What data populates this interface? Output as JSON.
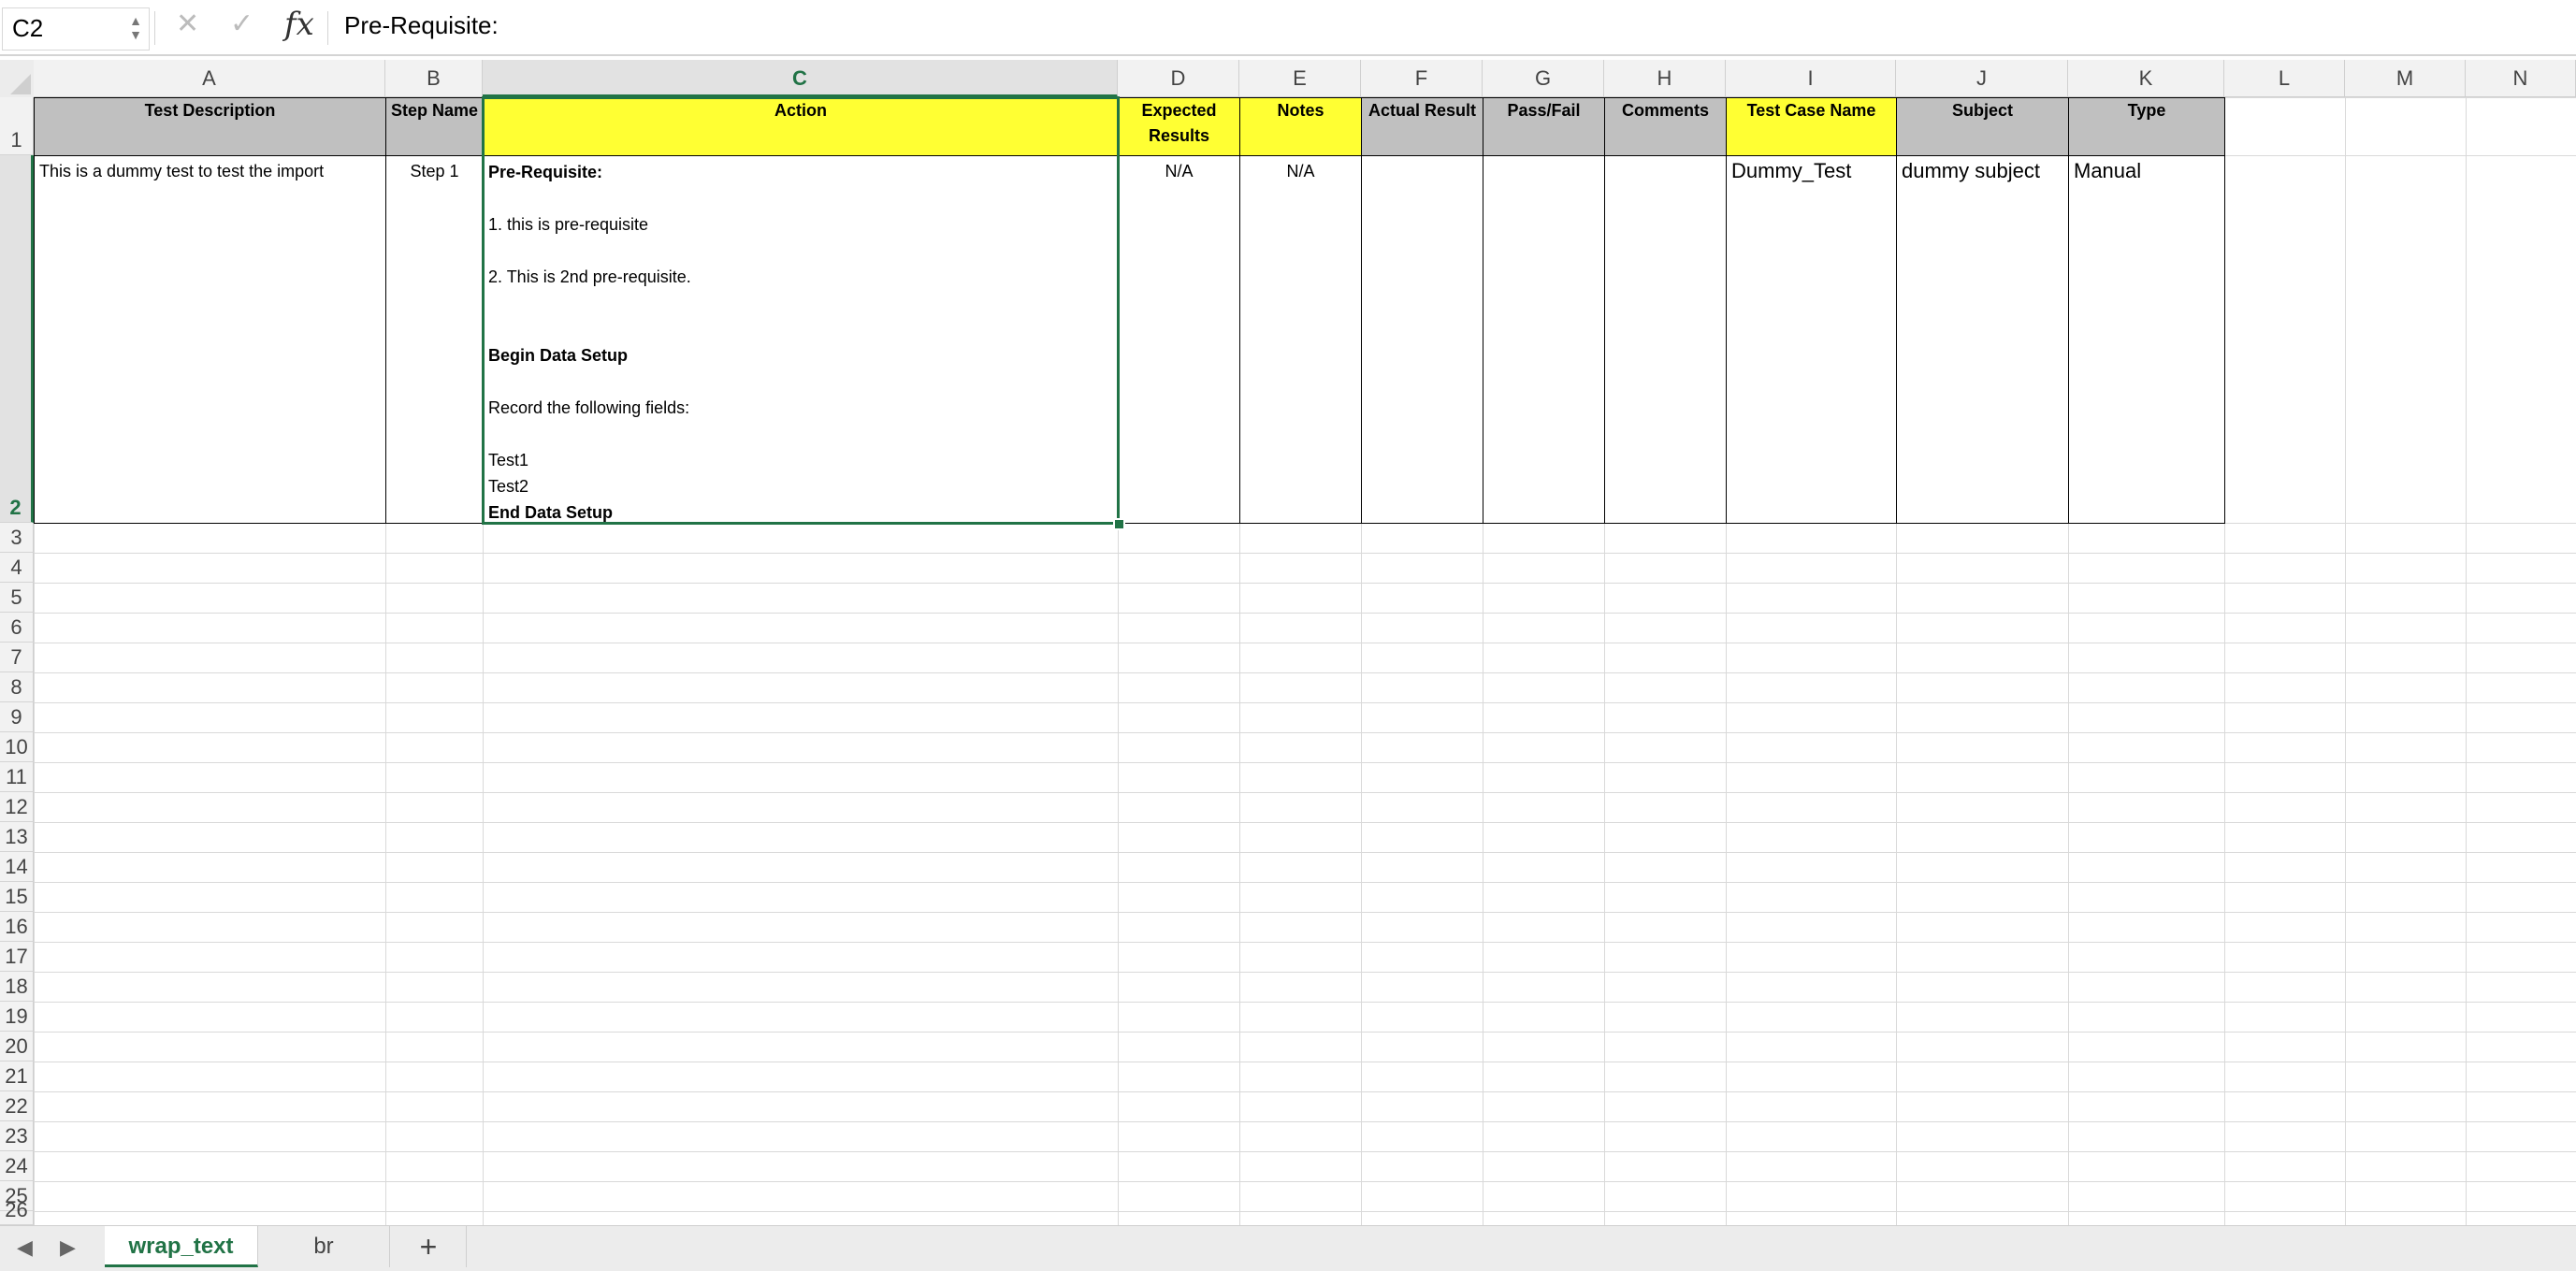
{
  "formula_bar": {
    "name_box": "C2",
    "cancel_glyph": "✕",
    "enter_glyph": "✓",
    "fx_label": "fx",
    "formula": "Pre-Requisite:"
  },
  "columns": [
    "A",
    "B",
    "C",
    "D",
    "E",
    "F",
    "G",
    "H",
    "I",
    "J",
    "K",
    "L",
    "M",
    "N"
  ],
  "selected_column": "C",
  "rows": [
    "1",
    "2",
    "3",
    "4",
    "5",
    "6",
    "7",
    "8",
    "9",
    "10",
    "11",
    "12",
    "13",
    "14",
    "15",
    "16",
    "17",
    "18",
    "19",
    "20",
    "21",
    "22",
    "23",
    "24",
    "25",
    "26"
  ],
  "selected_row": "2",
  "header_row": [
    {
      "col": "A",
      "text": "Test Description",
      "fill": "gray"
    },
    {
      "col": "B",
      "text": "Step Name",
      "fill": "gray"
    },
    {
      "col": "C",
      "text": "Action",
      "fill": "yellow"
    },
    {
      "col": "D",
      "text": "Expected Results",
      "fill": "yellow"
    },
    {
      "col": "E",
      "text": "Notes",
      "fill": "yellow"
    },
    {
      "col": "F",
      "text": "Actual Result",
      "fill": "gray"
    },
    {
      "col": "G",
      "text": "Pass/Fail",
      "fill": "gray"
    },
    {
      "col": "H",
      "text": "Comments",
      "fill": "gray"
    },
    {
      "col": "I",
      "text": "Test Case Name",
      "fill": "yellow"
    },
    {
      "col": "J",
      "text": "Subject",
      "fill": "gray"
    },
    {
      "col": "K",
      "text": "Type",
      "fill": "gray"
    }
  ],
  "data_row": {
    "A": "This is a dummy test to test the import",
    "B": "Step 1",
    "C_lines": [
      {
        "text": "Pre-Requisite:",
        "bold": true
      },
      {
        "text": "",
        "bold": false
      },
      {
        "text": "1. this is pre-requisite",
        "bold": false
      },
      {
        "text": "",
        "bold": false
      },
      {
        "text": "2. This is 2nd pre-requisite.",
        "bold": false
      },
      {
        "text": "",
        "bold": false
      },
      {
        "text": "",
        "bold": false
      },
      {
        "text": "Begin Data Setup",
        "bold": true
      },
      {
        "text": "",
        "bold": false
      },
      {
        "text": "Record the following fields:",
        "bold": false
      },
      {
        "text": "",
        "bold": false
      },
      {
        "text": "Test1",
        "bold": false
      },
      {
        "text": "Test2",
        "bold": false
      },
      {
        "text": "End Data Setup",
        "bold": true
      }
    ],
    "D": "N/A",
    "E": "N/A",
    "F": "",
    "G": "",
    "H": "",
    "I": "Dummy_Test",
    "J": "dummy subject",
    "K": "Manual"
  },
  "colors": {
    "header_gray": "#c0c0c0",
    "header_yellow": "#ffff33",
    "selection": "#217346"
  },
  "sheet_tabs": {
    "prev_icon": "◀",
    "next_icon": "▶",
    "tabs": [
      {
        "label": "wrap_text",
        "active": true
      },
      {
        "label": "br",
        "active": false
      }
    ],
    "add_label": "+"
  }
}
